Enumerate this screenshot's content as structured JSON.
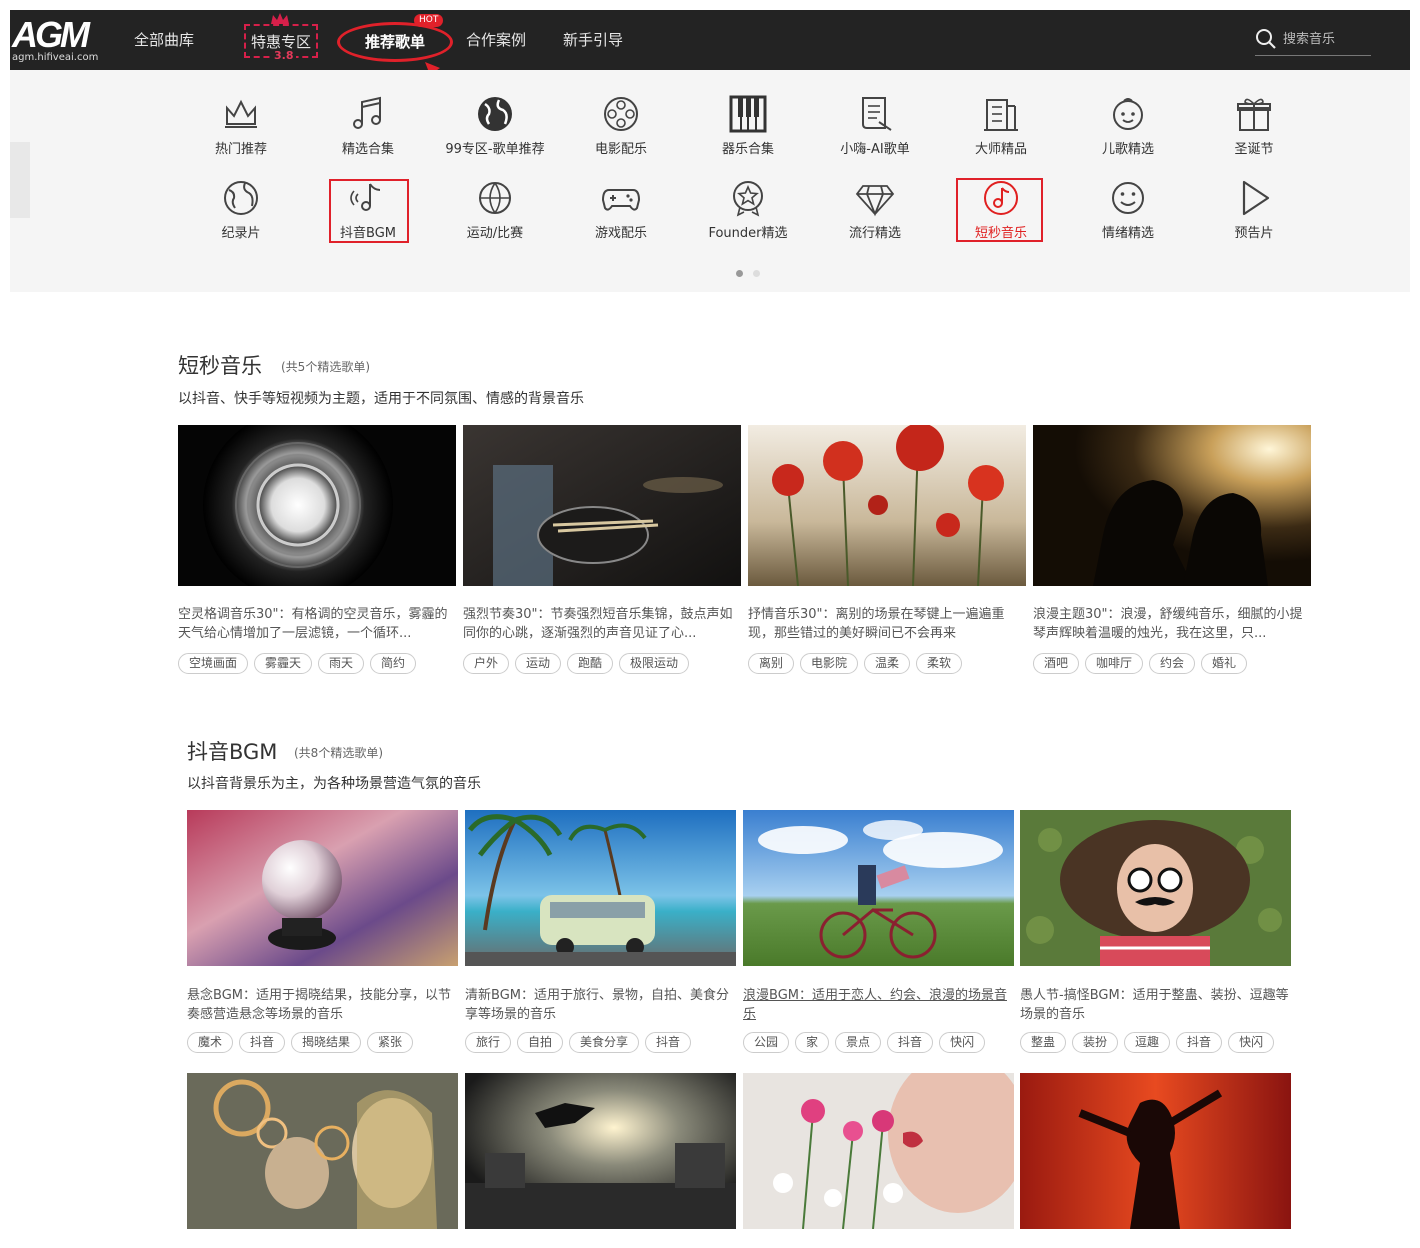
{
  "header": {
    "logo_main": "AGM",
    "logo_sub": "agm.hifiveai.com",
    "nav": {
      "all": "全部曲库",
      "special": "特惠专区",
      "special_badge": "3.8",
      "recommend": "推荐歌单",
      "hot": "HOT",
      "cases": "合作案例",
      "guide": "新手引导"
    },
    "search_placeholder": "搜索音乐"
  },
  "categories": [
    {
      "label": "热门推荐",
      "icon": "crown-icon"
    },
    {
      "label": "精选合集",
      "icon": "music-note-icon"
    },
    {
      "label": "99专区-歌单推荐",
      "icon": "globe-filled-icon"
    },
    {
      "label": "电影配乐",
      "icon": "film-reel-icon"
    },
    {
      "label": "器乐合集",
      "icon": "piano-icon"
    },
    {
      "label": "小嗨-AI歌单",
      "icon": "scroll-icon"
    },
    {
      "label": "大师精品",
      "icon": "building-icon"
    },
    {
      "label": "儿歌精选",
      "icon": "baby-face-icon"
    },
    {
      "label": "圣诞节",
      "icon": "gift-icon"
    },
    {
      "label": "纪录片",
      "icon": "earth-icon"
    },
    {
      "label": "抖音BGM",
      "icon": "tiktok-note-icon"
    },
    {
      "label": "运动/比赛",
      "icon": "ball-icon"
    },
    {
      "label": "游戏配乐",
      "icon": "gamepad-icon"
    },
    {
      "label": "Founder精选",
      "icon": "star-badge-icon"
    },
    {
      "label": "流行精选",
      "icon": "diamond-icon"
    },
    {
      "label": "短秒音乐",
      "icon": "disc-note-icon"
    },
    {
      "label": "情绪精选",
      "icon": "smile-icon"
    },
    {
      "label": "预告片",
      "icon": "play-icon"
    }
  ],
  "carousel": {
    "pages": 2,
    "active": 1
  },
  "sections": [
    {
      "title": "短秒音乐",
      "count": "(共5个精选歌单)",
      "desc": "以抖音、快手等短视频为主题，适用于不同氛围、情感的背景音乐",
      "cards": [
        {
          "desc": "空灵格调音乐30\"：有格调的空灵音乐，雾霾的天气给心情增加了一层滤镜，一个循环...",
          "tags": [
            "空境画面",
            "雾霾天",
            "雨天",
            "简约"
          ]
        },
        {
          "desc": "强烈节奏30\"：节奏强烈短音乐集锦，鼓点声如同你的心跳，逐渐强烈的声音见证了心...",
          "tags": [
            "户外",
            "运动",
            "跑酷",
            "极限运动"
          ]
        },
        {
          "desc": "抒情音乐30\"：离别的场景在琴键上一遍遍重现，那些错过的美好瞬间已不会再来",
          "tags": [
            "离别",
            "电影院",
            "温柔",
            "柔软"
          ]
        },
        {
          "desc": "浪漫主题30\"：浪漫，舒缓纯音乐，细腻的小提琴声辉映着温暖的烛光，我在这里，只...",
          "tags": [
            "酒吧",
            "咖啡厅",
            "约会",
            "婚礼"
          ]
        }
      ]
    },
    {
      "title": "抖音BGM",
      "count": "(共8个精选歌单)",
      "desc": "以抖音背景乐为主，为各种场景营造气氛的音乐",
      "cards": [
        {
          "desc": "悬念BGM：适用于揭晓结果，技能分享，以节奏感营造悬念等场景的音乐",
          "tags": [
            "魔术",
            "抖音",
            "揭晓结果",
            "紧张"
          ]
        },
        {
          "desc": "清新BGM：适用于旅行、景物，自拍、美食分享等场景的音乐",
          "tags": [
            "旅行",
            "自拍",
            "美食分享",
            "抖音"
          ]
        },
        {
          "desc": "浪漫BGM：适用于恋人、约会、浪漫的场景音乐",
          "tags": [
            "公园",
            "家",
            "景点",
            "抖音",
            "快闪"
          ]
        },
        {
          "desc": "愚人节-搞怪BGM：适用于整蛊、装扮、逗趣等场景的音乐",
          "tags": [
            "整蛊",
            "装扮",
            "逗趣",
            "抖音",
            "快闪"
          ]
        }
      ]
    }
  ],
  "colors": {
    "header_bg": "#232323",
    "panel_bg": "#f5f5f5",
    "accent_red": "#e0212a"
  }
}
